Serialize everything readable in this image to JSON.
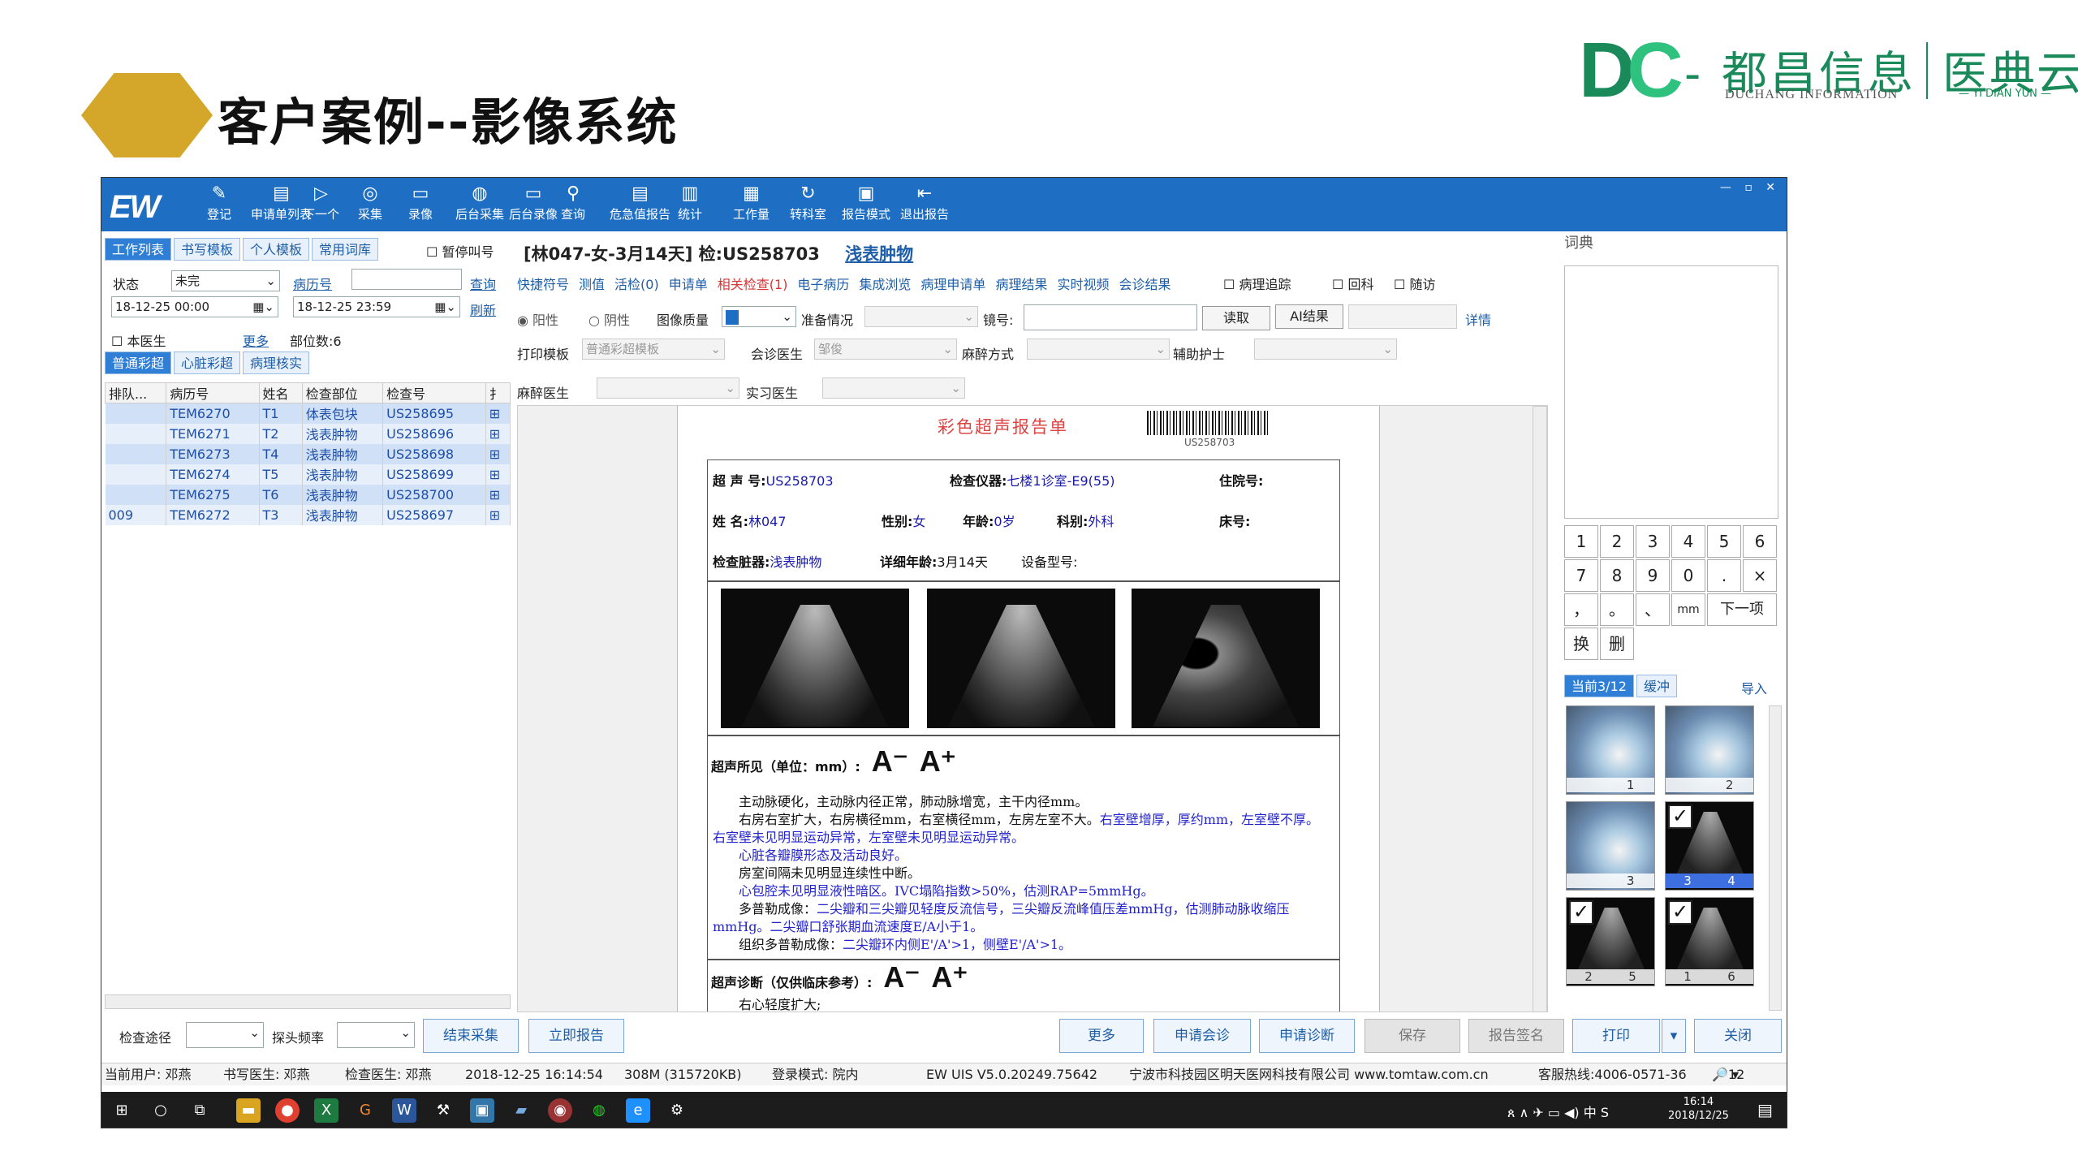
{
  "slide": {
    "title": "客户案例--影像系统"
  },
  "logo": {
    "mark": "DC",
    "separator": "-",
    "cn_name": "都昌信息",
    "en_name": "DUCHANG INFORMATION",
    "product_cn": "医典云",
    "product_en": "— YI DIAN YUN —",
    "colors": {
      "brand": "#1a8a5a",
      "accent": "#2ec27e",
      "hexagon": "#d4a62a"
    }
  },
  "app": {
    "logo": "EW",
    "window_controls": "— ▫ ✕",
    "toolbar": [
      {
        "label": "登记",
        "icon": "register-icon"
      },
      {
        "label": "申请单列表",
        "icon": "list-icon"
      },
      {
        "label": "下一个",
        "icon": "next-icon"
      },
      {
        "label": "采集",
        "icon": "camera-icon"
      },
      {
        "label": "录像",
        "icon": "video-icon"
      },
      {
        "label": "后台采集",
        "icon": "camera-bg-icon"
      },
      {
        "label": "后台录像",
        "icon": "video-bg-icon"
      },
      {
        "label": "查询",
        "icon": "search-icon"
      },
      {
        "label": "危急值报告",
        "icon": "alert-report-icon"
      },
      {
        "label": "统计",
        "icon": "chart-icon"
      },
      {
        "label": "工作量",
        "icon": "workload-icon"
      },
      {
        "label": "转科室",
        "icon": "transfer-icon"
      },
      {
        "label": "报告模式",
        "icon": "layout-icon"
      },
      {
        "label": "退出报告",
        "icon": "exit-icon"
      }
    ],
    "left": {
      "tabs": [
        "工作列表",
        "书写模板",
        "个人模板",
        "常用词库"
      ],
      "pause_call": "暂停叫号",
      "status_label": "状态",
      "status_value": "未完",
      "record_label": "病历号",
      "record_value": "",
      "query": "查询",
      "refresh": "刷新",
      "date_from": "18-12-25 00:00",
      "date_to": "18-12-25 23:59",
      "my_doctor": "本医生",
      "more": "更多",
      "part_count": "部位数:6",
      "subtabs": [
        "普通彩超",
        "心脏彩超",
        "病理核实"
      ],
      "columns": [
        "排队...",
        "病历号",
        "姓名",
        "检查部位",
        "检查号",
        "扌"
      ],
      "rows": [
        [
          "",
          "TEM6270",
          "T1",
          "体表包块",
          "US258695",
          "⊞"
        ],
        [
          "",
          "TEM6271",
          "T2",
          "浅表肿物",
          "US258696",
          "⊞"
        ],
        [
          "",
          "TEM6273",
          "T4",
          "浅表肿物",
          "US258698",
          "⊞"
        ],
        [
          "",
          "TEM6274",
          "T5",
          "浅表肿物",
          "US258699",
          "⊞"
        ],
        [
          "",
          "TEM6275",
          "T6",
          "浅表肿物",
          "US258700",
          "⊞"
        ],
        [
          "009",
          "TEM6272",
          "T3",
          "浅表肿物",
          "US258697",
          "⊞"
        ]
      ],
      "exam_path": "检查途径",
      "probe_freq": "探头频率"
    },
    "header": {
      "patient": "[林047-女-3月14天] 检:US258703",
      "exam_part": "浅表肿物"
    },
    "links": [
      "快捷符号",
      "测值",
      "活检(0)",
      "申请单",
      "相关检查(1)",
      "电子病历",
      "集成浏览",
      "病理申请单",
      "病理结果",
      "实时视频",
      "会诊结果"
    ],
    "checks": {
      "pathology_track": "病理追踪",
      "revisit": "回科",
      "follow": "随访"
    },
    "row2": {
      "positive": "阳性",
      "negative": "阴性",
      "image_quality": "图像质量",
      "prep": "准备情况",
      "mirror": "镜号:",
      "read": "读取",
      "ai": "AI结果",
      "detail": "详情"
    },
    "row3": {
      "print_tpl": "打印模板",
      "print_tpl_value": "普通彩超模板",
      "consult": "会诊医生",
      "consult_value": "邹俊",
      "anesthesia": "麻醉方式",
      "nurse": "辅助护士",
      "anes_doc": "麻醉医生",
      "intern": "实习医生"
    },
    "report": {
      "title": "彩色超声报告单",
      "barcode_text": "US258703",
      "us_no_label": "超 声 号:",
      "us_no": "US258703",
      "device_label": "检查仪器:",
      "device": "七楼1诊室-E9(55)",
      "inpatient_label": "住院号:",
      "name_label": "姓  名:",
      "name": "林047",
      "sex_label": "性别:",
      "sex": "女",
      "age_label": "年龄:",
      "age": "0岁",
      "dept_label": "科别:",
      "dept": "外科",
      "bed_label": "床号:",
      "organ_label": "检查脏器:",
      "organ": "浅表肿物",
      "detail_age_label": "详细年龄:",
      "detail_age": "3月14天",
      "model_label": "设备型号:",
      "findings_label": "超声所见（单位：mm）:",
      "a_minus": "A⁻",
      "a_plus": "A⁺",
      "findings": [
        {
          "t": "主动脉硬化，主动脉内径正常，肺动脉增宽，主干内径mm。",
          "c": false,
          "i": true
        },
        {
          "t": "右房右室扩大，右房横径mm，右室横径mm，左房左室不大。",
          "c": false,
          "i": true,
          "tail": "右室壁增厚，厚约mm，左室壁不厚。"
        },
        {
          "t": "右室壁未见明显运动异常，左室壁未见明显运动异常。",
          "c": true,
          "i": false
        },
        {
          "t": "心脏各瓣膜形态及活动良好。",
          "c": true,
          "i": true
        },
        {
          "t": "房室间隔未见明显连续性中断。",
          "c": false,
          "i": true
        },
        {
          "t": "心包腔未见明显液性暗区。IVC塌陷指数>50%，估测RAP=5mmHg。",
          "c": true,
          "i": true
        },
        {
          "t": "多普勒成像：",
          "c": false,
          "i": true,
          "tail": "二尖瓣和三尖瓣见轻度反流信号，三尖瓣反流峰值压差mmHg，估测肺动脉收缩压"
        },
        {
          "t": "mmHg。二尖瓣口舒张期血流速度E/A小于1。",
          "c": true,
          "i": false
        },
        {
          "t": "组织多普勒成像：",
          "c": false,
          "i": true,
          "tail": "二尖瓣环内侧E'/A'>1，侧壁E'/A'>1。"
        }
      ],
      "diagnosis_label": "超声诊断（仅供临床参考）:",
      "diagnosis": "右心轻度扩大;"
    },
    "right": {
      "dict": "词典",
      "keys": [
        "1",
        "2",
        "3",
        "4",
        "5",
        "6",
        "7",
        "8",
        "9",
        "0",
        ".",
        "×",
        "，",
        "。",
        "、",
        "mm",
        "下一项",
        "",
        "换",
        "删"
      ],
      "thumb_tabs": [
        "当前3/12",
        "缓冲"
      ],
      "import": "导入",
      "thumbs": [
        {
          "a": "",
          "b": "1",
          "kind": "blur",
          "checked": false,
          "hl": false
        },
        {
          "a": "",
          "b": "2",
          "kind": "blur",
          "checked": false,
          "hl": false
        },
        {
          "a": "",
          "b": "3",
          "kind": "blur",
          "checked": false,
          "hl": false
        },
        {
          "a": "3",
          "b": "4",
          "kind": "us",
          "checked": true,
          "hl": true
        },
        {
          "a": "2",
          "b": "5",
          "kind": "us",
          "checked": true,
          "hl": false
        },
        {
          "a": "1",
          "b": "6",
          "kind": "us",
          "checked": true,
          "hl": false
        }
      ]
    },
    "buttons": {
      "end_collect": "结束采集",
      "report_now": "立即报告",
      "more": "更多",
      "req_consult": "申请会诊",
      "req_diag": "申请诊断",
      "save": "保存",
      "sign": "报告签名",
      "print": "打印",
      "close": "关闭"
    },
    "status": {
      "user": "当前用户: 邓燕",
      "writer": "书写医生: 邓燕",
      "checker": "检查医生: 邓燕",
      "time": "2018-12-25 16:14:54",
      "mem": "308M (315720KB)",
      "mode": "登录模式: 院内",
      "version": "EW UIS V5.0.20249.75642",
      "company": "宁波市科技园区明天医网科技有限公司 www.tomtaw.com.cn",
      "hotline": "客服热线:4006-0571-36",
      "badge": "12"
    },
    "taskbar": {
      "time": "16:14",
      "date": "2018/12/25",
      "ime": "中"
    }
  }
}
